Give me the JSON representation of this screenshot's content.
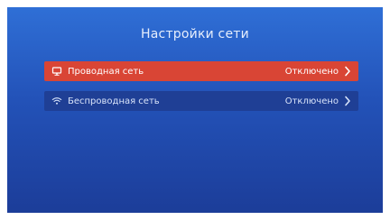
{
  "screen": {
    "title": "Настройки сети"
  },
  "network_items": [
    {
      "label": "Проводная сеть",
      "status": "Отключено",
      "icon": "monitor-icon",
      "selected": true
    },
    {
      "label": "Беспроводная сеть",
      "status": "Отключено",
      "icon": "wifi-icon",
      "selected": false
    }
  ],
  "colors": {
    "background_top": "#2f6fd6",
    "background_bottom": "#1c3d99",
    "selected_row": "#d94535",
    "row": "#1f3f95",
    "text": "#ffffff"
  }
}
